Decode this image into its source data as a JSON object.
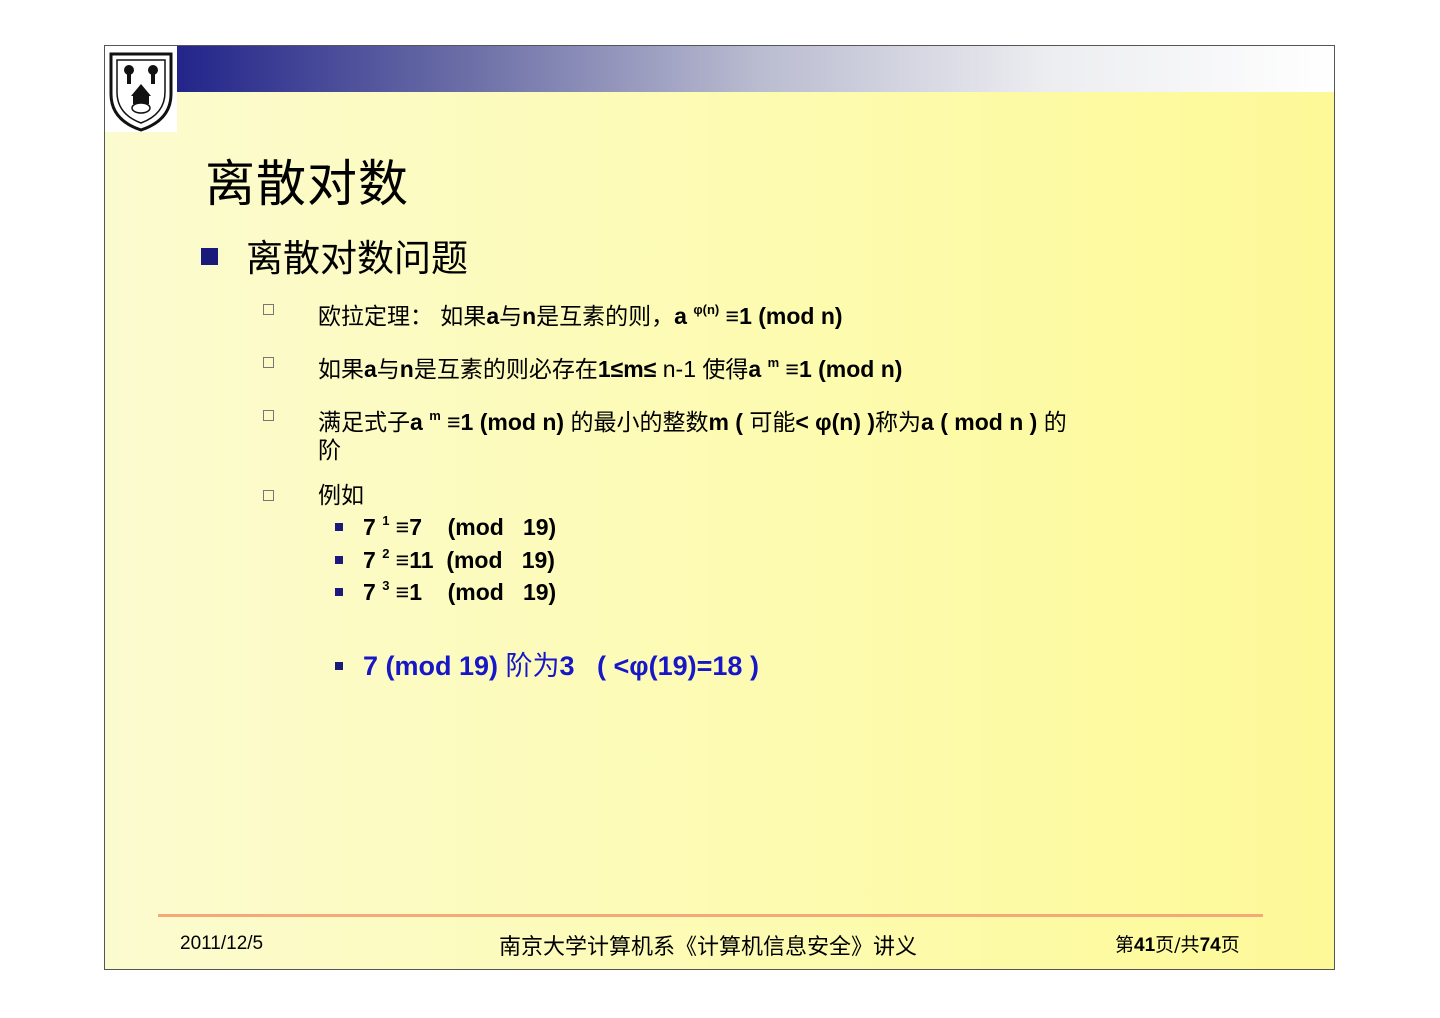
{
  "slide": {
    "title": "离散对数",
    "bullet_l1": "离散对数问题",
    "items": [
      {
        "pre": "欧拉定理：  如果",
        "a": "a",
        "mid1": "与",
        "n": "n",
        "mid2": "是互素的则，",
        "expr1": "a ",
        "sup": "φ(n)",
        "expr2": " ≡1 (mod   n)"
      },
      {
        "pre": "如果",
        "a": "a",
        "mid1": "与",
        "n": "n",
        "mid2": "是互素的则必存在",
        "expr1": "1≤m≤",
        "expr2": " n-1 ",
        "mid3": "使得",
        "expr3": "a ",
        "sup": "m",
        "expr4": " ≡1 (mod   n)"
      },
      {
        "pre": "满足式子",
        "expr1": "a ",
        "sup": "m",
        "expr2": " ≡1 (mod   n) ",
        "mid1": "的最小的整数",
        "expr3": "m ( ",
        "mid2": "可能",
        "expr4": "< φ(n) )",
        "mid3": "称为",
        "expr5": "a ( mod   n ) ",
        "mid4": "的",
        "line2": "阶"
      },
      {
        "label": "例如"
      }
    ],
    "examples": [
      {
        "base": "7 ",
        "sup": "1",
        "rest": " ≡7    (mod   19)"
      },
      {
        "base": "7 ",
        "sup": "2",
        "rest": " ≡11  (mod   19)"
      },
      {
        "base": "7 ",
        "sup": "3",
        "rest": " ≡1    (mod   19)"
      }
    ],
    "conclusion": {
      "pre": "7 (mod 19) ",
      "cn": "阶为",
      "post": "3   ( <φ(19)=18 )"
    }
  },
  "footer": {
    "date": "2011/12/5",
    "course": "南京大学计算机系《计算机信息安全》讲义",
    "page_prefix": "第",
    "page_num": "41",
    "page_mid": "页/共",
    "page_total": "74",
    "page_suffix": "页"
  },
  "colors": {
    "title_bar": "#22248a",
    "accent_blue": "#1717c8",
    "footer_line": "#f5a878",
    "background": "#fdfbb0"
  },
  "icons": {
    "logo": "university-seal-icon"
  }
}
